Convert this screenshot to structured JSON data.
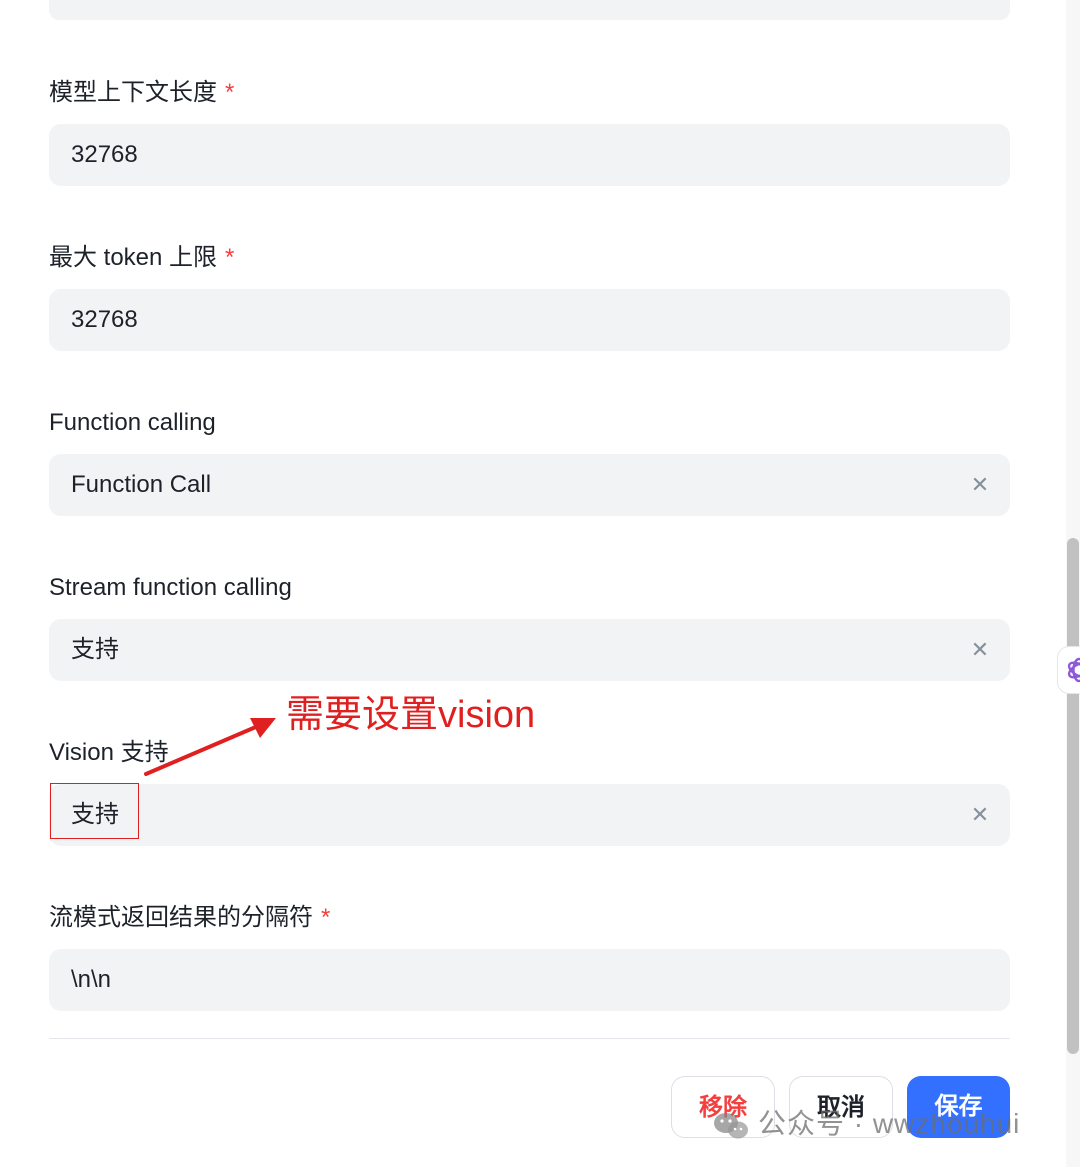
{
  "form": {
    "context_length": {
      "label": "模型上下文长度",
      "required_mark": "*",
      "value": "32768"
    },
    "max_token": {
      "label": "最大 token 上限",
      "required_mark": "*",
      "value": "32768"
    },
    "function_calling": {
      "label": "Function calling",
      "value": "Function Call"
    },
    "stream_function_calling": {
      "label": "Stream function calling",
      "value": "支持"
    },
    "vision": {
      "label": "Vision 支持",
      "value": "支持"
    },
    "stream_separator": {
      "label": "流模式返回结果的分隔符",
      "required_mark": "*",
      "value": "\\n\\n"
    }
  },
  "buttons": {
    "remove": "移除",
    "cancel": "取消",
    "save": "保存"
  },
  "annotation": {
    "text": "需要设置vision",
    "color": "#e02020"
  },
  "watermark": {
    "text": "公众号 · wwzhouhui"
  },
  "colors": {
    "primary": "#3370ff",
    "danger": "#f53f3f",
    "field_bg": "#f2f3f5"
  }
}
